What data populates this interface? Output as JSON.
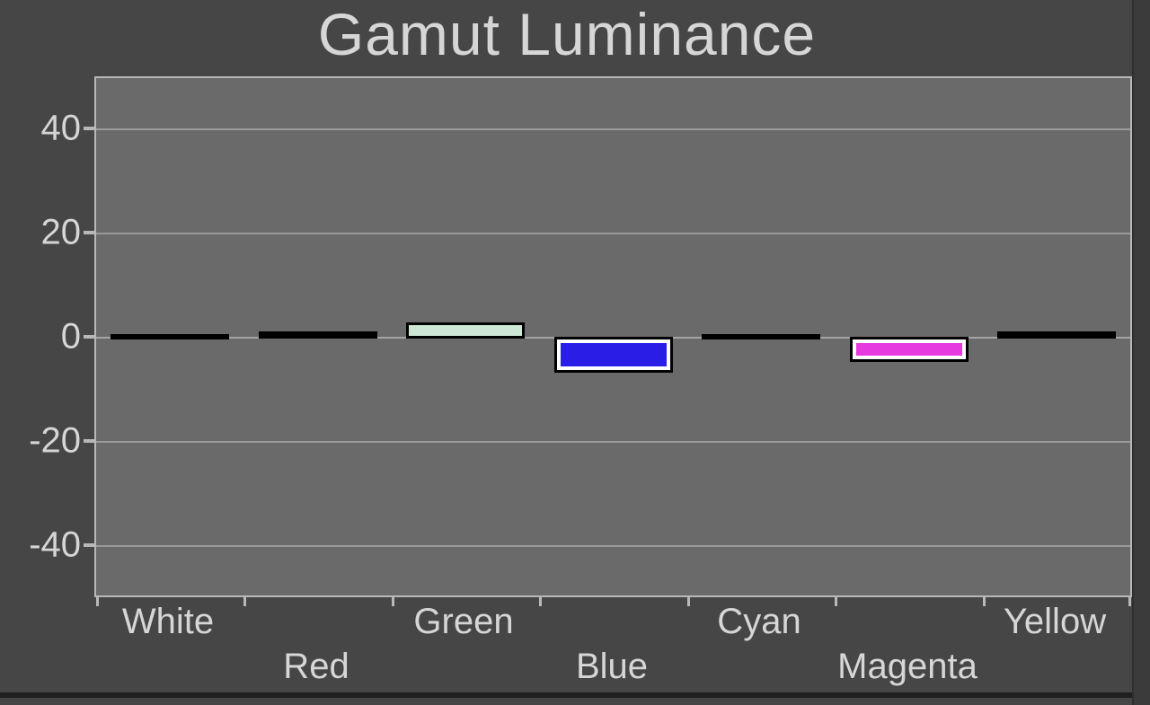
{
  "chart_data": {
    "type": "bar",
    "title": "Gamut Luminance",
    "xlabel": "",
    "ylabel": "",
    "ylim": [
      -50,
      50
    ],
    "yticks": [
      -40,
      -20,
      0,
      20,
      40
    ],
    "categories": [
      "White",
      "Red",
      "Green",
      "Blue",
      "Cyan",
      "Magenta",
      "Yellow"
    ],
    "values": [
      0,
      0.5,
      1.5,
      -5,
      0,
      -3,
      0.5
    ],
    "bar_colors": [
      "#000000",
      "#000000",
      "#cde6d5",
      "#2a1ee6",
      "#000000",
      "#e63ae0",
      "#000000"
    ]
  },
  "y_tick_labels": {
    "t0": "-40",
    "t1": "-20",
    "t2": "0",
    "t3": "20",
    "t4": "40"
  },
  "x_tick_labels": {
    "c0": "White",
    "c1": "Red",
    "c2": "Green",
    "c3": "Blue",
    "c4": "Cyan",
    "c5": "Magenta",
    "c6": "Yellow"
  },
  "title": "Gamut Luminance"
}
